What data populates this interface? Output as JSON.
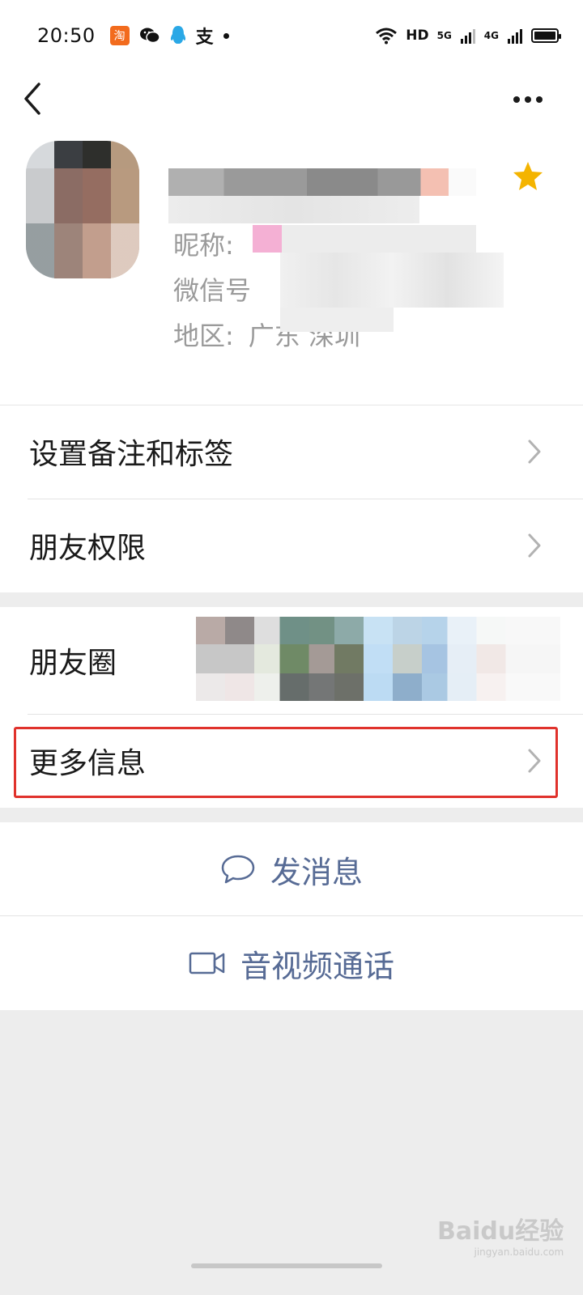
{
  "status_bar": {
    "time": "20:50",
    "app_badges": [
      "淘",
      "wechat-icon",
      "qq-icon",
      "支"
    ],
    "network": "HD",
    "signal_5g": "5G",
    "signal_4g": "4G"
  },
  "nav": {
    "back_icon": "chevron-left-icon",
    "more_icon": "more-dots-icon"
  },
  "profile": {
    "starred": true,
    "nickname_label": "昵称:",
    "wechat_id_label": "微信号",
    "region_label": "地区:",
    "region_value": "广东 深圳"
  },
  "cells": {
    "remark_tags": "设置备注和标签",
    "friend_permissions": "朋友权限",
    "moments": "朋友圈",
    "more_info": "更多信息"
  },
  "actions": {
    "send_message": "发消息",
    "video_call": "音视频通话"
  },
  "colors": {
    "link_blue": "#576b95",
    "highlight_red": "#e0322c",
    "star_yellow": "#f4b400",
    "background": "#ededed"
  },
  "watermark": {
    "brand": "Baidu经验",
    "url": "jingyan.baidu.com"
  }
}
